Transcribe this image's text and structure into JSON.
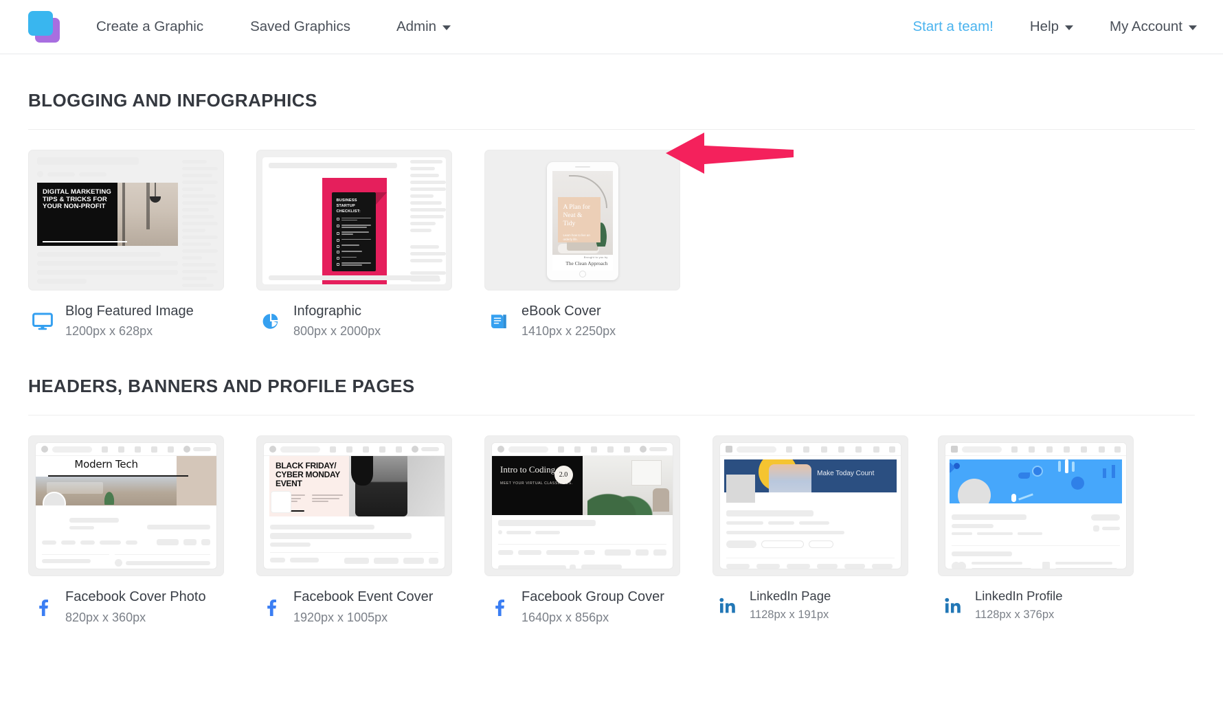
{
  "nav": {
    "logo_colors": {
      "blue": "#39b6ef",
      "purple": "#a86ee0"
    },
    "left_items": [
      {
        "label": "Create a Graphic",
        "caret": false
      },
      {
        "label": "Saved Graphics",
        "caret": false
      },
      {
        "label": "Admin",
        "caret": true
      }
    ],
    "right_items": [
      {
        "label": "Start a team!",
        "caret": false,
        "accent": "#4ab3ee"
      },
      {
        "label": "Help",
        "caret": true
      },
      {
        "label": "My Account",
        "caret": true
      }
    ]
  },
  "sections": [
    {
      "title": "BLOGGING AND INFOGRAPHICS",
      "cards": [
        {
          "title": "Blog Featured Image",
          "dims": "1200px x 628px",
          "icon": "monitor-icon"
        },
        {
          "title": "Infographic",
          "dims": "800px x 2000px",
          "icon": "pie-chart-icon"
        },
        {
          "title": "eBook Cover",
          "dims": "1410px x 2250px",
          "icon": "book-icon"
        }
      ]
    },
    {
      "title": "HEADERS, BANNERS AND PROFILE PAGES",
      "cards": [
        {
          "title": "Facebook Cover Photo",
          "dims": "820px x 360px",
          "icon": "facebook-icon"
        },
        {
          "title": "Facebook Event Cover",
          "dims": "1920px x 1005px",
          "icon": "facebook-icon"
        },
        {
          "title": "Facebook Group Cover",
          "dims": "1640px x 856px",
          "icon": "facebook-icon"
        },
        {
          "title": "LinkedIn Page",
          "dims": "1128px x 191px",
          "icon": "linkedin-icon"
        },
        {
          "title": "LinkedIn Profile",
          "dims": "1128px x 376px",
          "icon": "linkedin-icon"
        }
      ]
    }
  ],
  "thumbnails": {
    "blog_featured": {
      "headline": "DIGITAL MARKETING TIPS & TRICKS FOR YOUR NON-PROFIT"
    },
    "infographic": {
      "headline": "BUSINESS STARTUP CHECKLIST:",
      "accent_color": "#e51f5c",
      "items": [
        "FIND A GOOD BUSINESS IDEA",
        "TEST YOUR IDEA WITH MARKET RESEARCH",
        "CREATE A BUSINESS PLAN",
        "BRAND YOUR BUSINESS",
        "MAKE IT LEGAL",
        "GET FINANCED",
        "SET UP SHOP",
        "MARKET AND LAUNCH YOUR BUSINESS"
      ]
    },
    "ebook_cover": {
      "title": "A Plan for Neat & Tidy",
      "subtitle": "Learn how to live an orderly life.",
      "footer_small": "Brought to you by",
      "footer_brand": "The Clean Approach"
    },
    "facebook_cover_photo": {
      "title": "Modern Tech"
    },
    "facebook_event_cover": {
      "headline": "BLACK FRIDAY/ CYBER MONDAY EVENT",
      "background_color": "#fbeeea"
    },
    "facebook_group_cover": {
      "title": "Intro to Coding",
      "badge": "2.0",
      "subtitle": "MEET YOUR VIRTUAL CLASSMATES."
    },
    "linkedin_page": {
      "title": "Make Today Count",
      "banner_color": "#2b4f81",
      "accent_color": "#f5c431"
    },
    "linkedin_profile": {
      "banner_color": "#46a7fb"
    }
  },
  "annotation": {
    "arrow": {
      "color": "#f4215c",
      "direction": "left",
      "points_to": "eBook Cover"
    }
  }
}
